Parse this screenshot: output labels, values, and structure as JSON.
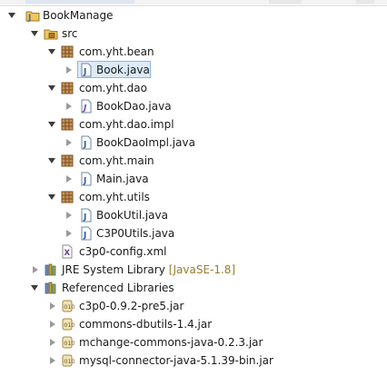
{
  "tree": {
    "project": "BookManage",
    "src": "src",
    "packages": [
      {
        "name": "com.yht.bean",
        "files": [
          "Book.java"
        ]
      },
      {
        "name": "com.yht.dao",
        "files": [
          "BookDao.java"
        ]
      },
      {
        "name": "com.yht.dao.impl",
        "files": [
          "BookDaoImpl.java"
        ]
      },
      {
        "name": "com.yht.main",
        "files": [
          "Main.java"
        ]
      },
      {
        "name": "com.yht.utils",
        "files": [
          "BookUtil.java",
          "C3P0Utils.java"
        ]
      }
    ],
    "config_file": "c3p0-config.xml",
    "jre": {
      "label": "JRE System Library",
      "decoration": "[JavaSE-1.8]"
    },
    "referenced": {
      "label": "Referenced Libraries",
      "jars": [
        "c3p0-0.9.2-pre5.jar",
        "commons-dbutils-1.4.jar",
        "mchange-commons-java-0.2.3.jar",
        "mysql-connector-java-5.1.39-bin.jar"
      ]
    },
    "selected": "Book.java"
  }
}
